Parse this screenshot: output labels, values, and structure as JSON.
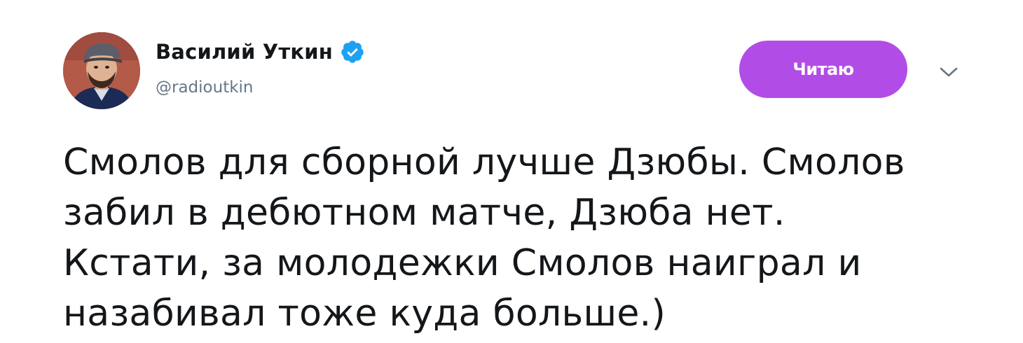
{
  "author": {
    "name": "Василий Уткин",
    "handle": "@radioutkin",
    "verified_color": "#1da1f2"
  },
  "follow_button": {
    "label": "Читаю",
    "color": "#b14de6"
  },
  "menu": {
    "icon": "chevron-down-icon"
  },
  "tweet": {
    "lines": [
      "Смолов для сборной лучше Дзюбы. Смолов",
      "забил в дебютном матче, Дзюба нет.",
      "Кстати, за молодежки Смолов наиграл и",
      "назабивал тоже куда больше.)"
    ]
  }
}
